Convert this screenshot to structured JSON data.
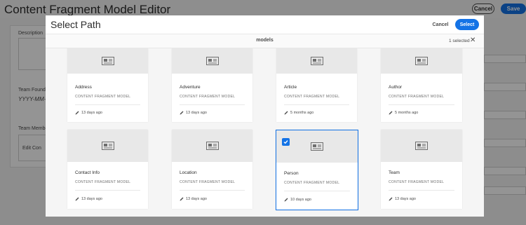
{
  "editor": {
    "title": "Content Fragment Model Editor",
    "cancel_label": "Cancel",
    "save_label": "Save",
    "fields": {
      "description_label": "Description",
      "team_founding_label": "Team Foundi",
      "team_founding_placeholder": "YYYY-MM-D",
      "team_members_label": "Team Membe",
      "edit_content_label": "Edit Con"
    }
  },
  "dialog": {
    "title": "Select Path",
    "cancel_label": "Cancel",
    "select_label": "Select",
    "folder": "models",
    "selection_count": "1 selected"
  },
  "cards": [
    {
      "name": "Address",
      "type": "CONTENT FRAGMENT MODEL",
      "modified": "13 days ago",
      "selected": false
    },
    {
      "name": "Adventure",
      "type": "CONTENT FRAGMENT MODEL",
      "modified": "13 days ago",
      "selected": false
    },
    {
      "name": "Article",
      "type": "CONTENT FRAGMENT MODEL",
      "modified": "5 months ago",
      "selected": false
    },
    {
      "name": "Author",
      "type": "CONTENT FRAGMENT MODEL",
      "modified": "5 months ago",
      "selected": false
    },
    {
      "name": "Contact Info",
      "type": "CONTENT FRAGMENT MODEL",
      "modified": "13 days ago",
      "selected": false
    },
    {
      "name": "Location",
      "type": "CONTENT FRAGMENT MODEL",
      "modified": "13 days ago",
      "selected": false
    },
    {
      "name": "Person",
      "type": "CONTENT FRAGMENT MODEL",
      "modified": "10 days ago",
      "selected": true
    },
    {
      "name": "Team",
      "type": "CONTENT FRAGMENT MODEL",
      "modified": "13 days ago",
      "selected": false
    }
  ],
  "colors": {
    "accent": "#1473e6",
    "overlay": "#000000"
  },
  "icons": {
    "thumbnail": "content-fragment-model-icon",
    "modified": "pencil-icon",
    "checkbox": "checkmark-icon",
    "clear": "close-icon"
  }
}
